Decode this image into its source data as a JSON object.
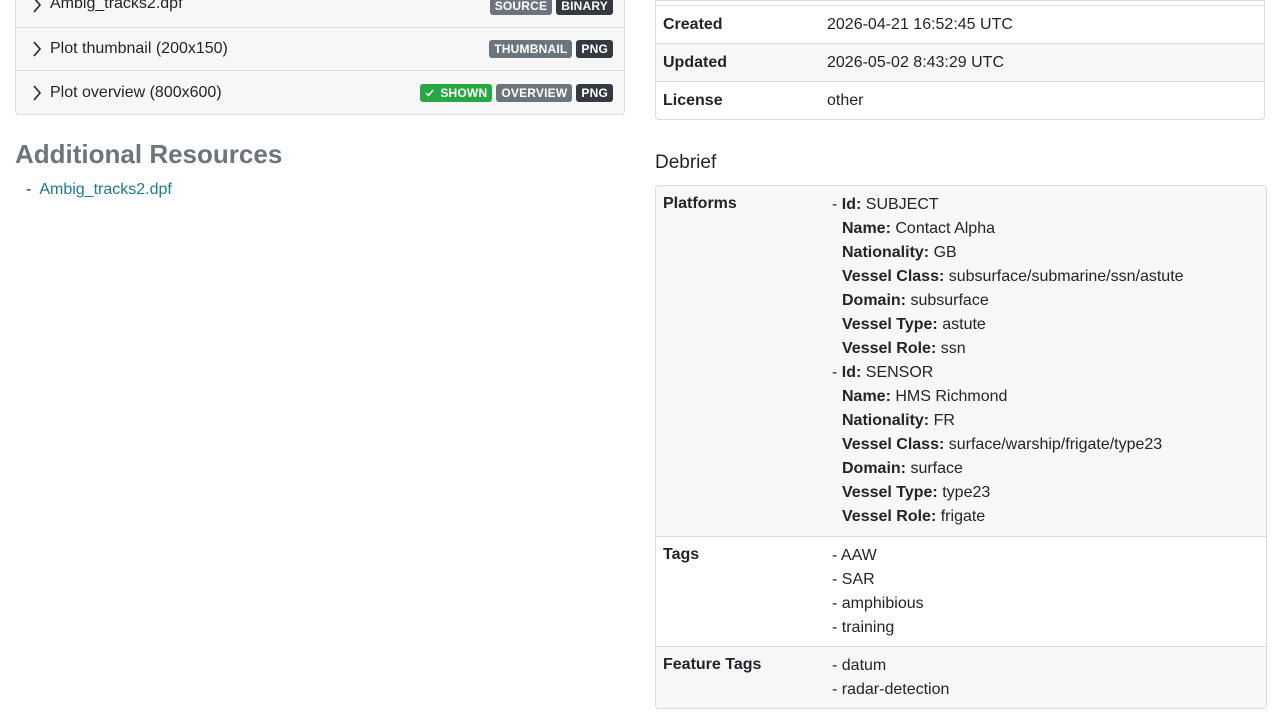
{
  "resources": [
    {
      "name": "Ambig_tracks2.dpf",
      "badges": [
        {
          "text": "SOURCE",
          "style": "gray"
        },
        {
          "text": "BINARY",
          "style": "dark"
        }
      ]
    },
    {
      "name": "Plot thumbnail (200x150)",
      "badges": [
        {
          "text": "THUMBNAIL",
          "style": "gray"
        },
        {
          "text": "PNG",
          "style": "dark"
        }
      ]
    },
    {
      "name": "Plot overview (800x600)",
      "badges": [
        {
          "text": "SHOWN",
          "style": "green"
        },
        {
          "text": "OVERVIEW",
          "style": "gray"
        },
        {
          "text": "PNG",
          "style": "dark"
        }
      ]
    }
  ],
  "additional": {
    "title": "Additional Resources",
    "items": [
      "Ambig_tracks2.dpf"
    ]
  },
  "metadata": [
    {
      "label": "Created",
      "value": "2026-04-21 16:52:45 UTC"
    },
    {
      "label": "Updated",
      "value": "2026-05-02 8:43:29 UTC"
    },
    {
      "label": "License",
      "value": "other"
    }
  ],
  "debrief": {
    "title": "Debrief",
    "platforms_label": "Platforms",
    "field_labels": {
      "id": "Id:",
      "name": "Name:",
      "nationality": "Nationality:",
      "vessel_class": "Vessel Class:",
      "domain": "Domain:",
      "vessel_type": "Vessel Type:",
      "vessel_role": "Vessel Role:"
    },
    "platforms": [
      {
        "id": "SUBJECT",
        "name": "Contact Alpha",
        "nationality": "GB",
        "vessel_class": "subsurface/submarine/ssn/astute",
        "domain": "subsurface",
        "vessel_type": "astute",
        "vessel_role": "ssn"
      },
      {
        "id": "SENSOR",
        "name": "HMS Richmond",
        "nationality": "FR",
        "vessel_class": "surface/warship/frigate/type23",
        "domain": "surface",
        "vessel_type": "type23",
        "vessel_role": "frigate"
      }
    ],
    "tags_label": "Tags",
    "tags": [
      "AAW",
      "SAR",
      "amphibious",
      "training"
    ],
    "feature_tags_label": "Feature Tags",
    "feature_tags": [
      "datum",
      "radar-detection"
    ]
  },
  "colors": {
    "accent_link": "#1b7b8e",
    "badge_green": "#28a745",
    "badge_gray": "#6c757d",
    "badge_dark": "#343a40"
  },
  "icons": {
    "expand": "chevron-right-icon",
    "shown": "check-icon"
  }
}
